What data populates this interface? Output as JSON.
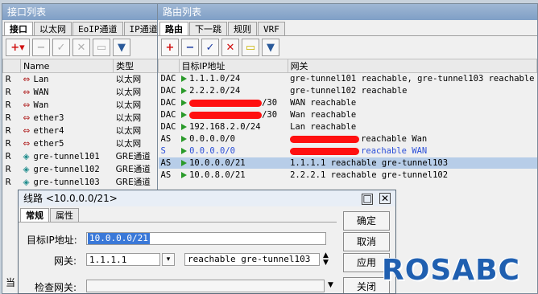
{
  "interface_window": {
    "title": "接口列表",
    "tabs": [
      "接口",
      "以太网",
      "EoIP通道",
      "IP通道"
    ],
    "columns": {
      "name": "Name",
      "type": "类型"
    },
    "rows": [
      {
        "flag": "R",
        "name": "Lan",
        "type": "以太网"
      },
      {
        "flag": "R",
        "name": "WAN",
        "type": "以太网"
      },
      {
        "flag": "R",
        "name": "Wan",
        "type": "以太网"
      },
      {
        "flag": "R",
        "name": "ether3",
        "type": "以太网"
      },
      {
        "flag": "R",
        "name": "ether4",
        "type": "以太网"
      },
      {
        "flag": "R",
        "name": "ether5",
        "type": "以太网"
      },
      {
        "flag": "R",
        "name": "gre-tunnel101",
        "type": "GRE通道"
      },
      {
        "flag": "R",
        "name": "gre-tunnel102",
        "type": "GRE通道"
      },
      {
        "flag": "R",
        "name": "gre-tunnel103",
        "type": "GRE通道"
      }
    ],
    "status_partial": "当"
  },
  "route_window": {
    "title": "路由列表",
    "tabs": [
      "路由",
      "下一跳",
      "规则",
      "VRF"
    ],
    "columns": {
      "dst": "目标IP地址",
      "gateway": "网关"
    },
    "rows": [
      {
        "flag": "DAC",
        "dst": "1.1.1.0/24",
        "gateway": "gre-tunnel101 reachable, gre-tunnel103 reachable"
      },
      {
        "flag": "DAC",
        "dst": "2.2.2.0/24",
        "gateway": "gre-tunnel102 reachable"
      },
      {
        "flag": "DAC",
        "dst": "/30",
        "gateway": "WAN reachable"
      },
      {
        "flag": "DAC",
        "dst": "/30",
        "gateway": "Wan reachable"
      },
      {
        "flag": "DAC",
        "dst": "192.168.2.0/24",
        "gateway": "Lan reachable"
      },
      {
        "flag": "AS",
        "dst": "0.0.0.0/0",
        "gateway": "reachable Wan"
      },
      {
        "flag": "S",
        "dst": "0.0.0.0/0",
        "gateway": "reachable WAN"
      },
      {
        "flag": "AS",
        "dst": "10.0.0.0/21",
        "gateway": "1.1.1.1 reachable gre-tunnel103"
      },
      {
        "flag": "AS",
        "dst": "10.0.8.0/21",
        "gateway": "2.2.2.1 reachable gre-tunnel102"
      }
    ]
  },
  "route_dialog": {
    "title": "线路 <10.0.0.0/21>",
    "tabs": [
      "常规",
      "属性"
    ],
    "dst_label": "目标IP地址:",
    "dst_value": "10.0.0.0/21",
    "gateway_label": "网关:",
    "gateway_value": "1.1.1.1",
    "gateway_status": "reachable gre-tunnel103",
    "check_gateway_label": "检查网关:",
    "buttons": {
      "ok": "确定",
      "cancel": "取消",
      "apply": "应用",
      "close": "关闭"
    }
  },
  "watermark": "ROSABC",
  "colors": {
    "selected_row": "#b7cde8",
    "static_blue": "#2b4fd8",
    "redaction": "#ff1010",
    "watermark": "#1f5fb0"
  }
}
